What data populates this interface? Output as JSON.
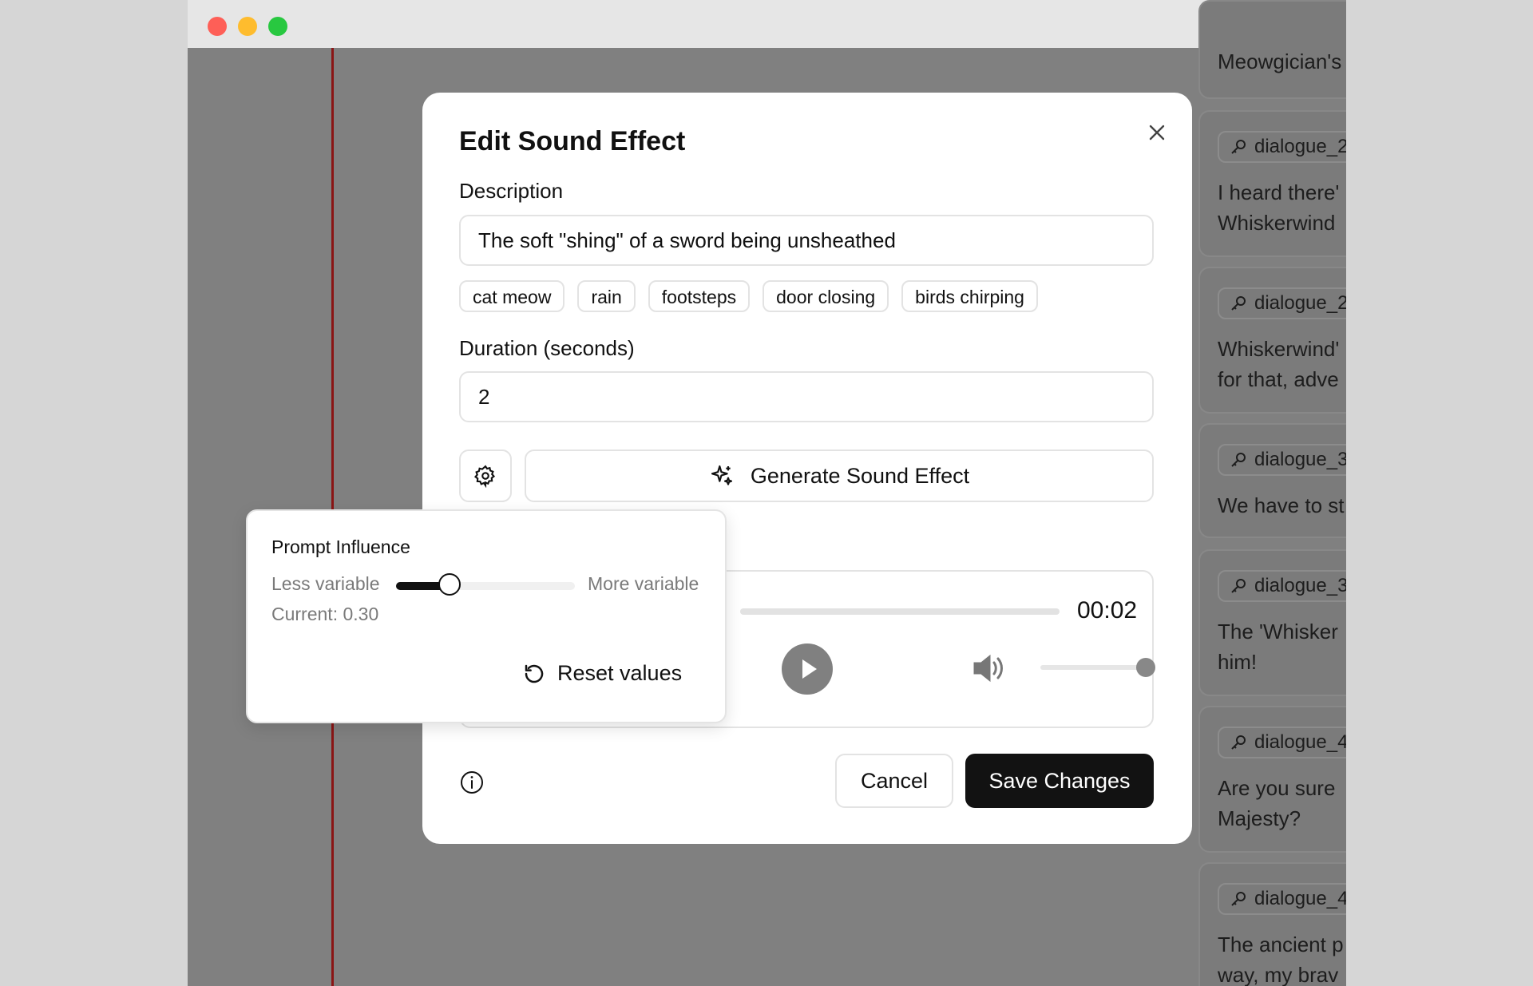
{
  "modal": {
    "title": "Edit Sound Effect",
    "description_label": "Description",
    "description_value": "The soft \"shing\" of a sword being unsheathed",
    "tags": [
      "cat meow",
      "rain",
      "footsteps",
      "door closing",
      "birds chirping"
    ],
    "duration_label": "Duration (seconds)",
    "duration_value": "2",
    "generate_label": "Generate Sound Effect",
    "player": {
      "time": "00:02",
      "progress": 0.0,
      "volume": 1.0
    },
    "cancel_label": "Cancel",
    "save_label": "Save Changes"
  },
  "popover": {
    "title": "Prompt Influence",
    "less_label": "Less variable",
    "more_label": "More variable",
    "current_text": "Current: 0.30",
    "slider_value": 0.3,
    "reset_label": "Reset values"
  },
  "background_list": [
    {
      "chip": "",
      "lines": [
        "Meowgician's"
      ]
    },
    {
      "chip": "dialogue_2",
      "lines": [
        "I heard there'",
        "Whiskerwind"
      ]
    },
    {
      "chip": "dialogue_2",
      "lines": [
        "Whiskerwind'",
        "for that, adve"
      ]
    },
    {
      "chip": "dialogue_3",
      "lines": [
        "We have to st"
      ]
    },
    {
      "chip": "dialogue_3",
      "lines": [
        "The 'Whisker",
        "him!"
      ]
    },
    {
      "chip": "dialogue_4",
      "lines": [
        "Are you sure",
        "Majesty?"
      ]
    },
    {
      "chip": "dialogue_4",
      "lines": [
        "The ancient p",
        "way, my brav"
      ]
    }
  ],
  "colors": {
    "accent": "#121212",
    "overlay": "#808080",
    "playhead": "#8a1515"
  }
}
